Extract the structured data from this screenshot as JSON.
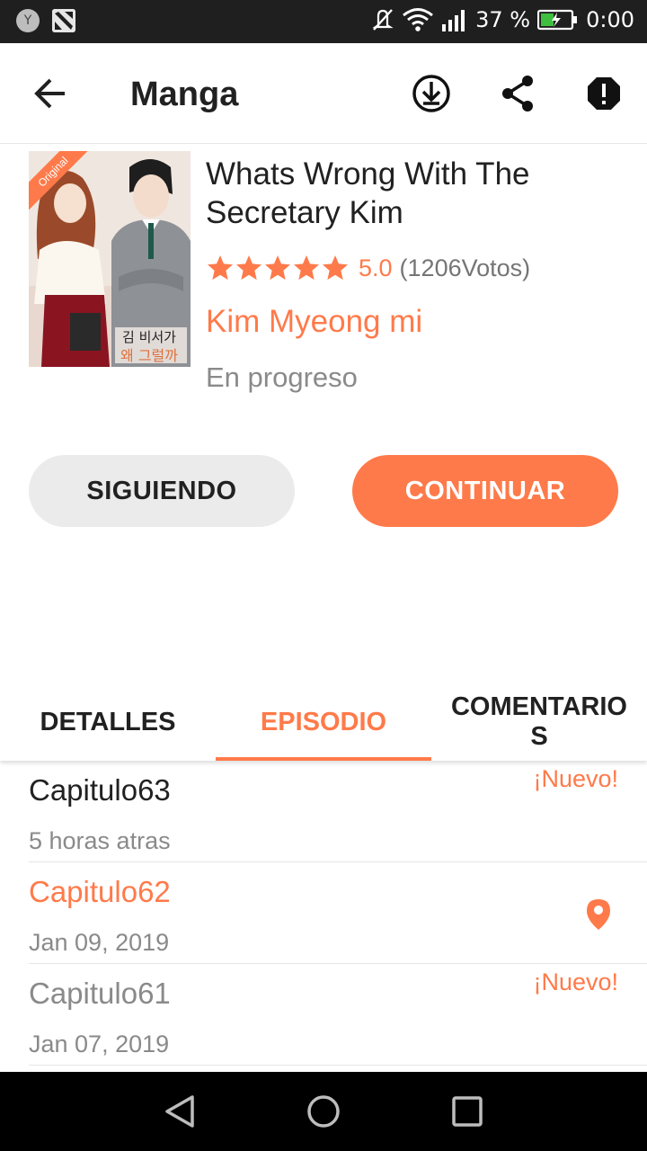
{
  "status_bar": {
    "avatar_letter": "Y",
    "battery_percent": "37 %",
    "time": "0:00"
  },
  "app_bar": {
    "title": "Manga",
    "icons": [
      "back-arrow-icon",
      "download-icon",
      "share-icon",
      "report-icon"
    ]
  },
  "manga": {
    "cover_badge": "Original",
    "cover_caption_line1": "김 비서가",
    "cover_caption_line2": "왜 그럴까",
    "title": "Whats Wrong With The Secretary Kim",
    "rating_stars": 5,
    "rating_value": "5.0",
    "votes": "(1206Votos)",
    "author": "Kim Myeong mi",
    "status": "En progreso"
  },
  "actions": {
    "follow_label": "SIGUIENDO",
    "continue_label": "CONTINUAR"
  },
  "tabs": {
    "details": "DETALLES",
    "episodes": "EPISODIO",
    "comments": "COMENTARIOS",
    "active": "EPISODIO"
  },
  "episodes": [
    {
      "name": "Capitulo63",
      "date": "5 horas atras",
      "badge": "¡Nuevo!",
      "read": false,
      "current": false
    },
    {
      "name": "Capitulo62",
      "date": "Jan 09, 2019",
      "badge": "",
      "read": false,
      "current": true
    },
    {
      "name": "Capitulo61",
      "date": "Jan 07, 2019",
      "badge": "¡Nuevo!",
      "read": true,
      "current": false
    }
  ],
  "colors": {
    "accent": "#ff7a4a",
    "text_primary": "#212121",
    "text_secondary": "#8a8a8a",
    "status_bar": "#1f1f1f",
    "nav_bar": "#000000"
  }
}
